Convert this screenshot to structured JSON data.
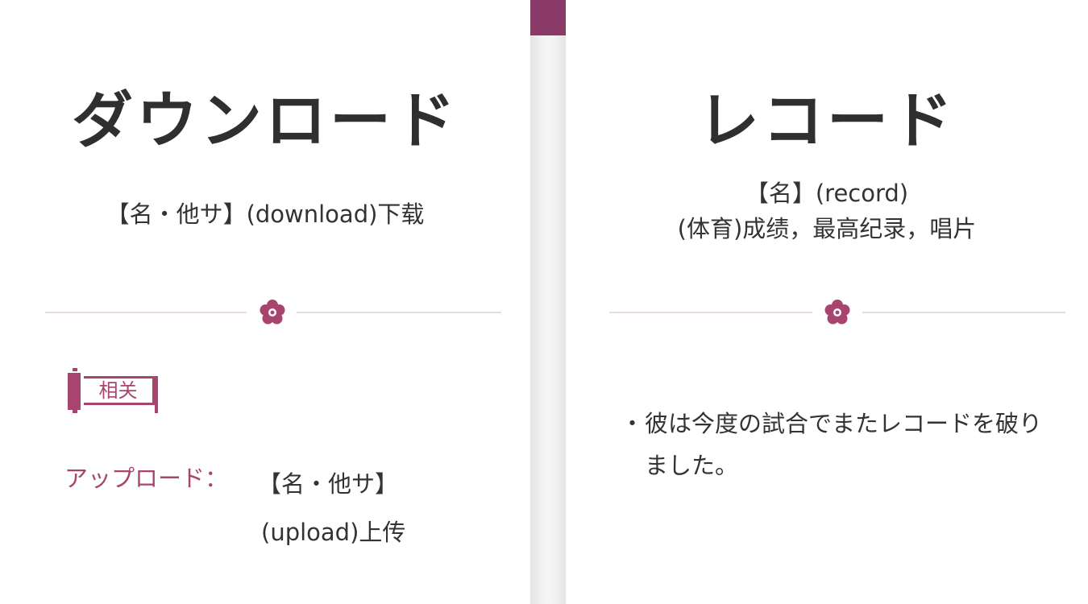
{
  "colors": {
    "accent": "#a8456f",
    "accent_dark": "#8a3a66",
    "text": "#333333",
    "divider_line": "#e8d8de",
    "background": "#ffffff"
  },
  "left_card": {
    "word": "ダウンロード",
    "meaning": "【名・他サ】(download)下载",
    "divider_icon": "sakura-flower-icon",
    "related_tag": "相关",
    "related_term": "アップロード：",
    "related_def_line1": "【名・他サ】",
    "related_def_line2": "(upload)上传"
  },
  "right_card": {
    "word": "レコード",
    "meaning_line1": "【名】(record)",
    "meaning_line2": "(体育)成绩，最高纪录，唱片",
    "divider_icon": "sakura-flower-icon",
    "example_bullet": "・",
    "example_text": "彼は今度の試合でまたレコードを破りました。"
  }
}
